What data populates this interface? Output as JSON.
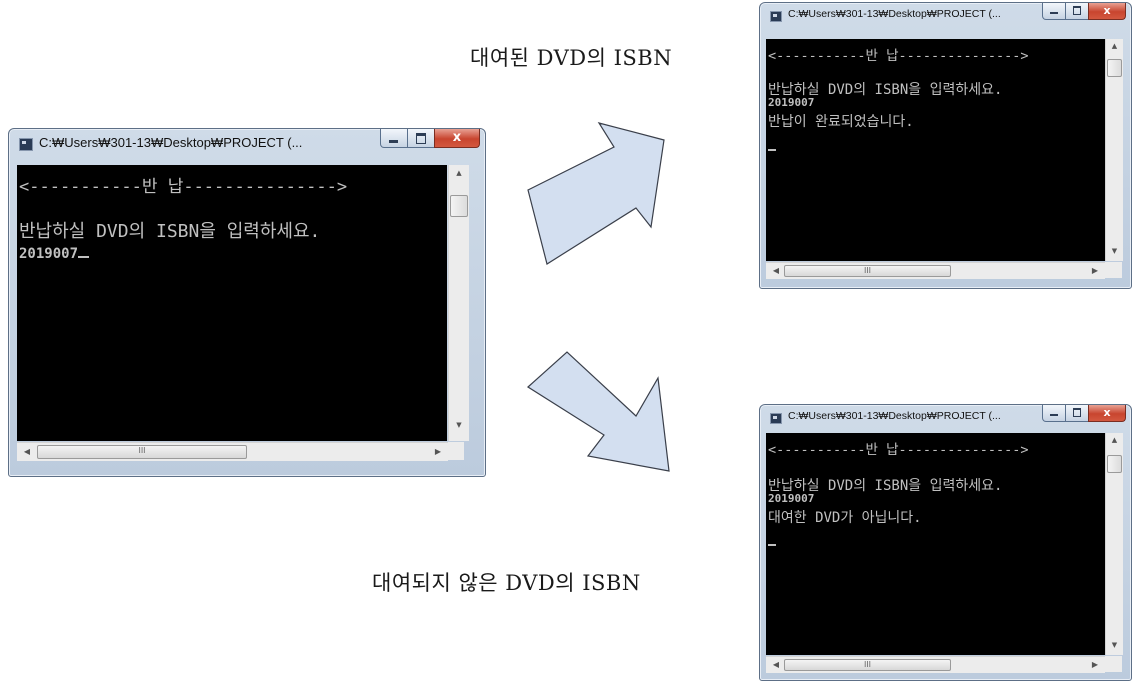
{
  "captions": {
    "returned_isbn": "대여된 DVD의 ISBN",
    "not_rented_isbn": "대여되지 않은 DVD의 ISBN"
  },
  "window": {
    "title": "C:₩Users₩301-13₩Desktop₩PROJECT (...",
    "close_glyph": "x"
  },
  "console": {
    "header": "<-----------반 납--------------->",
    "prompt": "반납하실 DVD의 ISBN을 입력하세요.",
    "isbn_input": "2019007",
    "result_success": "반납이 완료되었습니다.",
    "result_failure": "대여한 DVD가 아닙니다."
  },
  "scrollbar": {
    "up_arrow": "▲",
    "down_arrow": "▼",
    "left_arrow": "◀",
    "right_arrow": "▶",
    "thumb_grip": "III"
  },
  "colors": {
    "console_bg": "#000000",
    "console_fg": "#c0c0c0",
    "arrow_fill": "#d3dff0",
    "arrow_stroke": "#3a3f4a",
    "close_button": "#c8452f"
  },
  "icons": [
    "console-app-icon",
    "minimize-icon",
    "maximize-icon",
    "close-icon",
    "flow-arrow"
  ]
}
